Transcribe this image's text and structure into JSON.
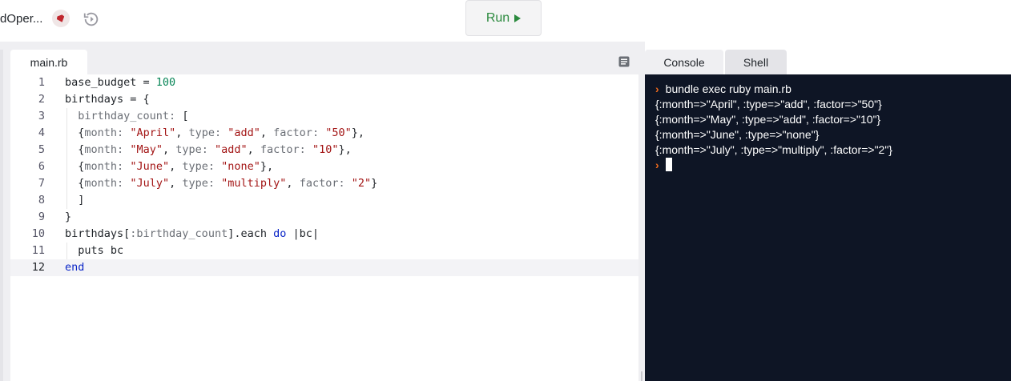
{
  "topbar": {
    "repl_name": "dOper...",
    "run_label": "Run"
  },
  "editor": {
    "file_tab": "main.rb",
    "lines": [
      {
        "num": "1",
        "tokens": [
          {
            "t": "base_budget = "
          },
          {
            "t": "100",
            "c": "n"
          }
        ]
      },
      {
        "num": "2",
        "tokens": [
          {
            "t": "birthdays = {"
          }
        ]
      },
      {
        "num": "3",
        "tokens": [
          {
            "t": "  "
          },
          {
            "t": "birthday_count:",
            "c": "sym"
          },
          {
            "t": " ["
          }
        ]
      },
      {
        "num": "4",
        "tokens": [
          {
            "t": "  {"
          },
          {
            "t": "month:",
            "c": "sym"
          },
          {
            "t": " "
          },
          {
            "t": "\"April\"",
            "c": "s"
          },
          {
            "t": ", "
          },
          {
            "t": "type:",
            "c": "sym"
          },
          {
            "t": " "
          },
          {
            "t": "\"add\"",
            "c": "s"
          },
          {
            "t": ", "
          },
          {
            "t": "factor:",
            "c": "sym"
          },
          {
            "t": " "
          },
          {
            "t": "\"50\"",
            "c": "s"
          },
          {
            "t": "},"
          }
        ]
      },
      {
        "num": "5",
        "tokens": [
          {
            "t": "  {"
          },
          {
            "t": "month:",
            "c": "sym"
          },
          {
            "t": " "
          },
          {
            "t": "\"May\"",
            "c": "s"
          },
          {
            "t": ", "
          },
          {
            "t": "type:",
            "c": "sym"
          },
          {
            "t": " "
          },
          {
            "t": "\"add\"",
            "c": "s"
          },
          {
            "t": ", "
          },
          {
            "t": "factor:",
            "c": "sym"
          },
          {
            "t": " "
          },
          {
            "t": "\"10\"",
            "c": "s"
          },
          {
            "t": "},"
          }
        ]
      },
      {
        "num": "6",
        "tokens": [
          {
            "t": "  {"
          },
          {
            "t": "month:",
            "c": "sym"
          },
          {
            "t": " "
          },
          {
            "t": "\"June\"",
            "c": "s"
          },
          {
            "t": ", "
          },
          {
            "t": "type:",
            "c": "sym"
          },
          {
            "t": " "
          },
          {
            "t": "\"none\"",
            "c": "s"
          },
          {
            "t": "},"
          }
        ]
      },
      {
        "num": "7",
        "tokens": [
          {
            "t": "  {"
          },
          {
            "t": "month:",
            "c": "sym"
          },
          {
            "t": " "
          },
          {
            "t": "\"July\"",
            "c": "s"
          },
          {
            "t": ", "
          },
          {
            "t": "type:",
            "c": "sym"
          },
          {
            "t": " "
          },
          {
            "t": "\"multiply\"",
            "c": "s"
          },
          {
            "t": ", "
          },
          {
            "t": "factor:",
            "c": "sym"
          },
          {
            "t": " "
          },
          {
            "t": "\"2\"",
            "c": "s"
          },
          {
            "t": "}"
          }
        ]
      },
      {
        "num": "8",
        "tokens": [
          {
            "t": "  ]"
          }
        ]
      },
      {
        "num": "9",
        "tokens": [
          {
            "t": "}"
          }
        ]
      },
      {
        "num": "10",
        "tokens": [
          {
            "t": "birthdays["
          },
          {
            "t": ":birthday_count",
            "c": "sym"
          },
          {
            "t": "].each "
          },
          {
            "t": "do",
            "c": "k"
          },
          {
            "t": " |bc|"
          }
        ]
      },
      {
        "num": "11",
        "tokens": [
          {
            "t": "  puts bc"
          }
        ]
      },
      {
        "num": "12",
        "tokens": [
          {
            "t": "end",
            "c": "k"
          }
        ]
      }
    ]
  },
  "panel": {
    "tabs": [
      "Console",
      "Shell"
    ],
    "command": "bundle exec ruby main.rb",
    "output": [
      "{:month=>\"April\", :type=>\"add\", :factor=>\"50\"}",
      "{:month=>\"May\", :type=>\"add\", :factor=>\"10\"}",
      "{:month=>\"June\", :type=>\"none\"}",
      "{:month=>\"July\", :type=>\"multiply\", :factor=>\"2\"}"
    ]
  },
  "icons": {
    "ruby": "ruby-gem-icon",
    "history": "history-icon",
    "notes": "notes-icon",
    "prompt": "prompt-chevron-icon"
  },
  "colors": {
    "run_green": "#2b8a3e",
    "console_bg": "#0e1525",
    "prompt_orange": "#f26b1d"
  }
}
